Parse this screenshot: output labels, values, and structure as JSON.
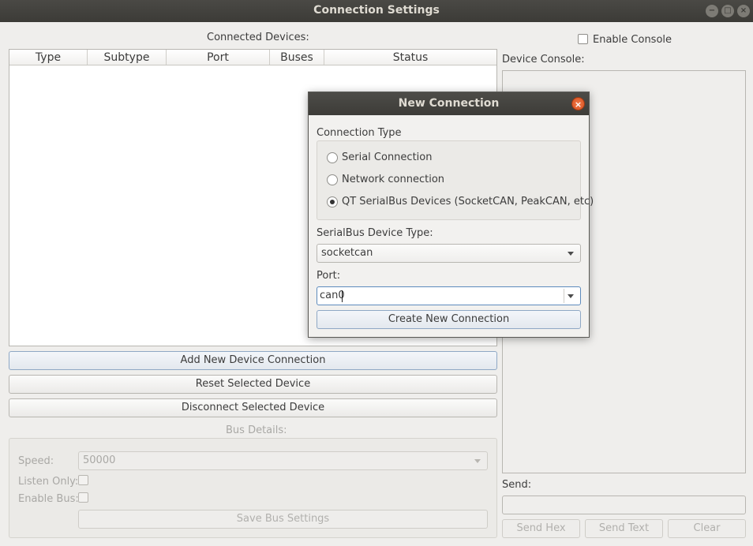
{
  "window": {
    "title": "Connection Settings",
    "controls": {
      "minimize": "−",
      "maximize": "□",
      "close": "×"
    }
  },
  "devices": {
    "label": "Connected Devices:",
    "columns": [
      "Type",
      "Subtype",
      "Port",
      "Buses",
      "Status"
    ]
  },
  "buttons": {
    "add": "Add New Device Connection",
    "reset": "Reset Selected Device",
    "disconnect": "Disconnect Selected Device"
  },
  "bus_details": {
    "label": "Bus Details:",
    "speed_label": "Speed:",
    "speed_value": "50000",
    "listen_label": "Listen Only:",
    "enable_label": "Enable Bus:",
    "save_button": "Save Bus Settings"
  },
  "console": {
    "enable_label": "Enable Console",
    "label": "Device Console:",
    "send_label": "Send:",
    "send_hex": "Send Hex",
    "send_text": "Send Text",
    "clear": "Clear"
  },
  "dialog": {
    "title": "New Connection",
    "close": "×",
    "connection_type_label": "Connection Type",
    "options": [
      "Serial Connection",
      "Network connection",
      "QT SerialBus Devices (SocketCAN, PeakCAN, etc)"
    ],
    "selected_index": 2,
    "device_type_label": "SerialBus Device Type:",
    "device_type_value": "socketcan",
    "port_label": "Port:",
    "port_value": "can0",
    "create_button": "Create New Connection"
  }
}
